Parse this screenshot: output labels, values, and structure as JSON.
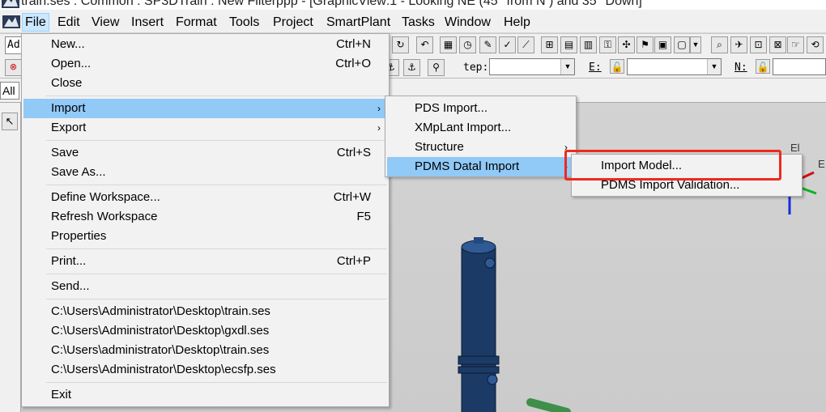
{
  "window": {
    "title": "train.ses : Common : SP3DTrain : New Filterppp - [GraphicView:1 - Looking NE (45° from N ) and 35° Down]"
  },
  "menubar": {
    "items": [
      "File",
      "Edit",
      "View",
      "Insert",
      "Format",
      "Tools",
      "Project",
      "SmartPlant",
      "Tasks",
      "Window",
      "Help"
    ]
  },
  "toolbar": {
    "step_label": "tep:",
    "e_label": "E:",
    "n_label": "N:",
    "left_box_1": "Ad",
    "left_box_2": "All"
  },
  "file_menu": {
    "items": [
      {
        "label": "New...",
        "shortcut": "Ctrl+N"
      },
      {
        "label": "Open...",
        "shortcut": "Ctrl+O"
      },
      {
        "label": "Close",
        "shortcut": ""
      },
      {
        "label": "Import",
        "shortcut": "",
        "submenu": true
      },
      {
        "label": "Export",
        "shortcut": "",
        "submenu": true
      },
      {
        "label": "Save",
        "shortcut": "Ctrl+S"
      },
      {
        "label": "Save As...",
        "shortcut": ""
      },
      {
        "label": "Define Workspace...",
        "shortcut": "Ctrl+W"
      },
      {
        "label": "Refresh Workspace",
        "shortcut": "F5"
      },
      {
        "label": "Properties",
        "shortcut": ""
      },
      {
        "label": "Print...",
        "shortcut": "Ctrl+P"
      },
      {
        "label": "Send...",
        "shortcut": ""
      },
      {
        "label": "C:\\Users\\Administrator\\Desktop\\train.ses",
        "shortcut": ""
      },
      {
        "label": "C:\\Users\\Administrator\\Desktop\\gxdl.ses",
        "shortcut": ""
      },
      {
        "label": "C:\\Users\\administrator\\Desktop\\train.ses",
        "shortcut": ""
      },
      {
        "label": "C:\\Users\\Administrator\\Desktop\\ecsfp.ses",
        "shortcut": ""
      },
      {
        "label": "Exit",
        "shortcut": ""
      }
    ]
  },
  "import_menu": {
    "items": [
      {
        "label": "PDS Import...",
        "submenu": false
      },
      {
        "label": "XMpLant Import...",
        "submenu": false
      },
      {
        "label": "Structure",
        "submenu": true
      },
      {
        "label": "PDMS Datal Import",
        "submenu": true
      }
    ]
  },
  "pdms_menu": {
    "items": [
      {
        "label": "Import Model..."
      },
      {
        "label": "PDMS Import Validation..."
      }
    ]
  },
  "axis": {
    "el_label": "El",
    "e_label": "E"
  },
  "colors": {
    "menu_highlight": "#91c9f7",
    "annotation_red": "#ee2a20",
    "vessel": "#1c3a66"
  }
}
